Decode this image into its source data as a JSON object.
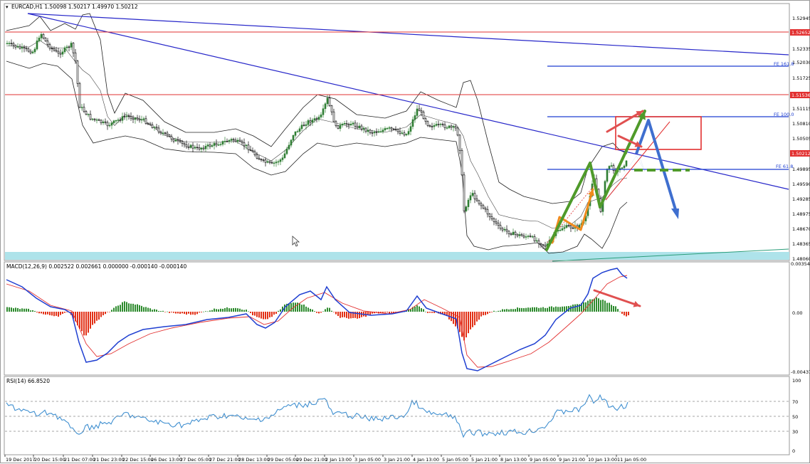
{
  "main_chart": {
    "header": "EURCAD,H1  1.50098 1.50217 1.49970 1.50212",
    "price_labels": [
      "1.52945",
      "1.52335",
      "1.52030",
      "1.51725",
      "1.51115",
      "1.50810",
      "1.50505",
      "1.49895",
      "1.49590",
      "1.49285",
      "1.48975",
      "1.48670",
      "1.48365",
      "1.48060"
    ],
    "hline_tags": [
      "1.52652",
      "1.51536",
      "1.50212"
    ],
    "fib_labels": [
      "FE 161.8",
      "FE 100.0",
      "FE 61.8"
    ]
  },
  "macd_panel": {
    "header": "MACD(12,26,9) 0.002522 0.002661 0.000000 -0.000140 -0.000140",
    "scale_labels": [
      "0.003549",
      "0.00",
      "-0.00437"
    ]
  },
  "rsi_panel": {
    "header": "RSI(14) 66.8520",
    "scale_labels": [
      "100",
      "70",
      "50",
      "30",
      "0"
    ]
  },
  "time_axis": {
    "labels": [
      "19 Dec 2017",
      "20 Dec 15:00",
      "21 Dec 07:00",
      "21 Dec 23:00",
      "22 Dec 15:00",
      "26 Dec 13:00",
      "27 Dec 05:00",
      "27 Dec 21:00",
      "28 Dec 13:00",
      "29 Dec 05:00",
      "29 Dec 21:00",
      "2 Jan 13:00",
      "3 Jan 05:00",
      "3 Jan 21:00",
      "4 Jan 13:00",
      "5 Jan 05:00",
      "5 Jan 21:00",
      "8 Jan 13:00",
      "9 Jan 05:00",
      "9 Jan 21:00",
      "10 Jan 13:00",
      "11 Jan 05:00"
    ]
  },
  "colors": {
    "bull_candle": "#2e7d32",
    "bear_candle": "#000000",
    "trendline": "#2626c9",
    "hline": "#e23030",
    "fib": "#1f3fd1",
    "macd_line": "#1f3fd1",
    "signal": "#e23030",
    "hist_pos": "#2e8b2e",
    "hist_neg": "#e23016",
    "rsi": "#3f8fd0",
    "arrow_orange": "#f08a1c",
    "arrow_green": "#4f9a2a",
    "arrow_blue": "#3f6fcf",
    "arrow_red": "#e05050",
    "band": "#aee3ea",
    "price_tag": "#e23030"
  }
}
